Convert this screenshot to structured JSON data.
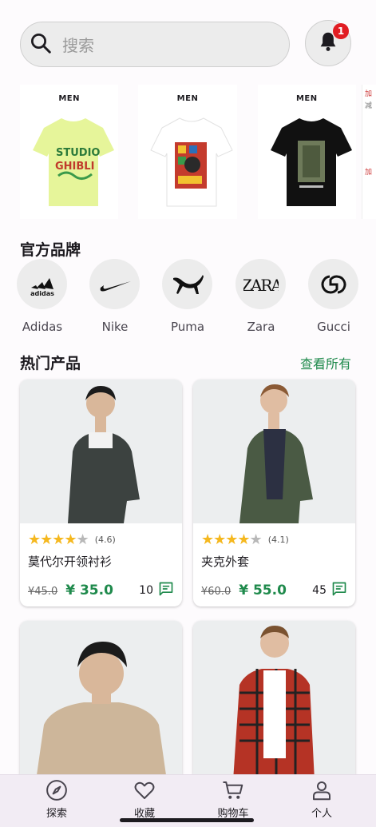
{
  "search": {
    "placeholder": "搜索",
    "notification_count": "1"
  },
  "banner": {
    "tiles": [
      {
        "label": "MEN"
      },
      {
        "label": "MEN"
      },
      {
        "label": "MEN"
      }
    ],
    "peek": [
      "加",
      "减",
      "加"
    ]
  },
  "brands_section": {
    "title": "官方品牌",
    "items": [
      {
        "label": "Adidas",
        "icon": "adidas-logo-icon"
      },
      {
        "label": "Nike",
        "icon": "nike-logo-icon"
      },
      {
        "label": "Puma",
        "icon": "puma-logo-icon"
      },
      {
        "label": "Zara",
        "icon": "zara-logo-icon"
      },
      {
        "label": "Gucci",
        "icon": "gucci-logo-icon"
      }
    ]
  },
  "popular_section": {
    "title": "热门产品",
    "view_all": "查看所有",
    "products": [
      {
        "name": "莫代尔开领衬衫",
        "rating": "(4.6)",
        "rating_value": 4.6,
        "old_price": "¥45.0",
        "price": "¥ 35.0",
        "reviews": "10"
      },
      {
        "name": "夹克外套",
        "rating": "(4.1)",
        "rating_value": 4.1,
        "old_price": "¥60.0",
        "price": "¥ 55.0",
        "reviews": "45"
      }
    ]
  },
  "nav": {
    "items": [
      {
        "label": "探索",
        "icon": "compass-icon"
      },
      {
        "label": "收藏",
        "icon": "heart-icon"
      },
      {
        "label": "购物车",
        "icon": "cart-icon"
      },
      {
        "label": "个人",
        "icon": "person-icon"
      }
    ]
  },
  "colors": {
    "accent": "#1f8a4c",
    "star": "#f5b81f",
    "badge": "#e11d23",
    "nav_bg": "#f2ecf4"
  }
}
